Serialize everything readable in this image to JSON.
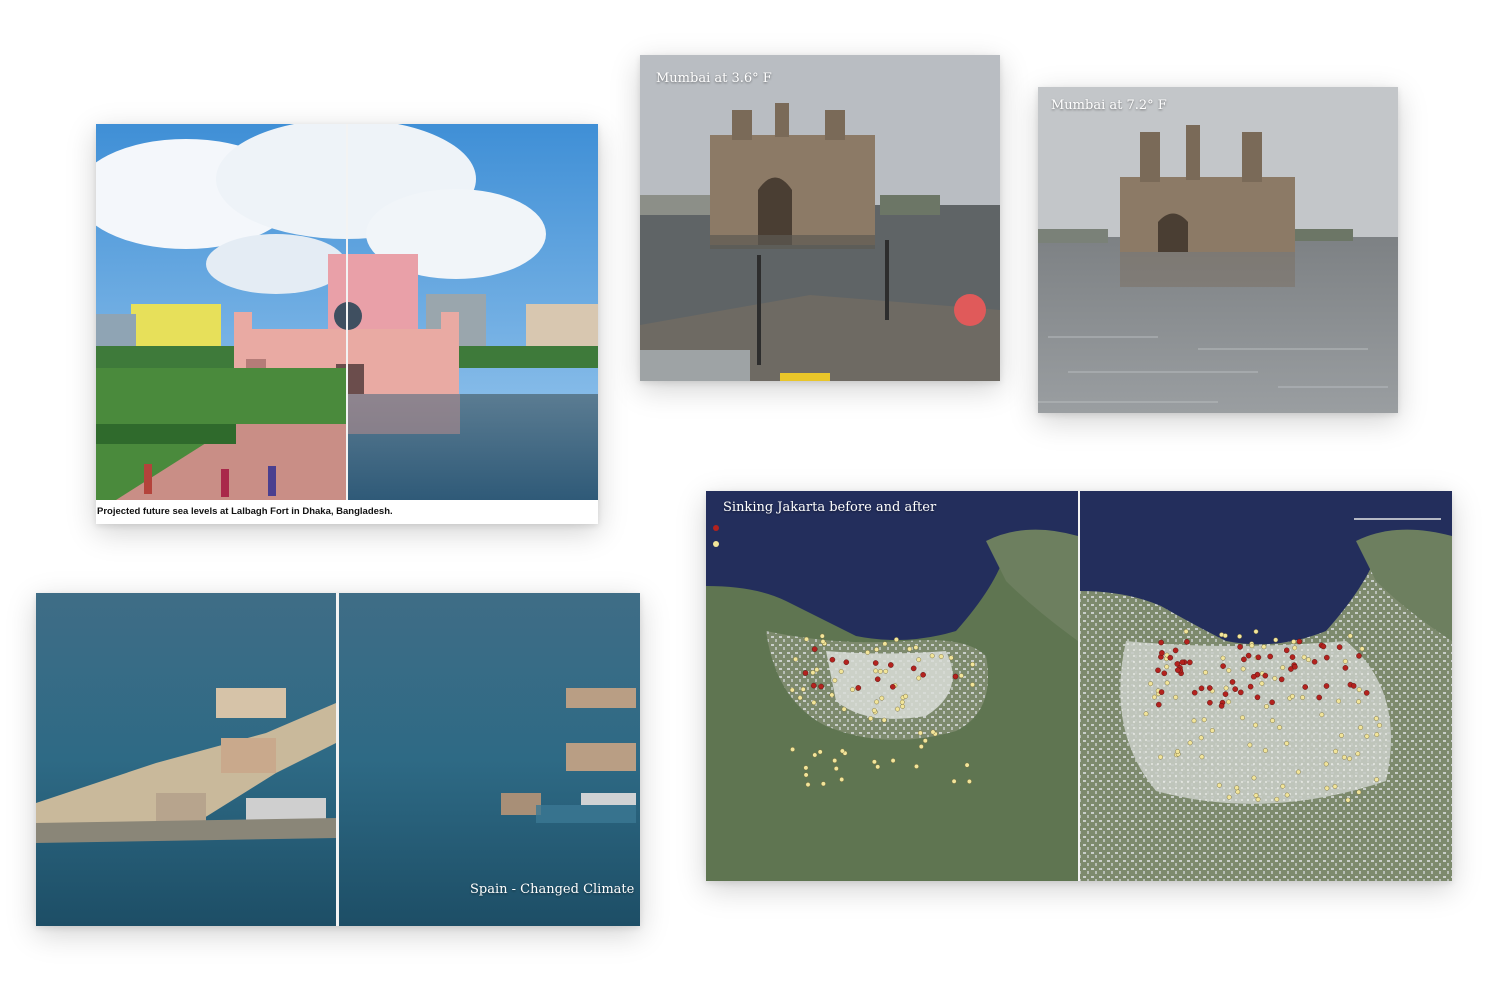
{
  "cards": {
    "dhaka": {
      "caption": "Projected future sea levels at Lalbagh Fort in Dhaka, Bangladesh."
    },
    "mumbai_a": {
      "caption": "Mumbai at 3.6° F"
    },
    "mumbai_b": {
      "caption": "Mumbai at 7.2° F"
    },
    "spain": {
      "caption": "Spain - Changed Climate"
    },
    "jakarta": {
      "caption": "Sinking Jakarta before and after"
    }
  },
  "colors": {
    "water": "#3f556a",
    "sky": "#5aa3dc",
    "fort": "#e5a6a0",
    "map_sea": "#232e5c",
    "dot_red": "#b3221e",
    "dot_yellow": "#f2e59a"
  }
}
